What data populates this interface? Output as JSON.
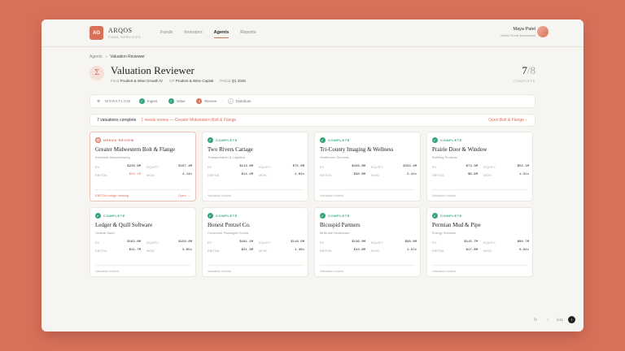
{
  "header": {
    "logo_text": "AG",
    "brand": "ARQOS",
    "brand_sub": "FUND SERVICES",
    "nav": [
      "Funds",
      "Investors",
      "Agents",
      "Reports"
    ],
    "active_nav": "Agents",
    "user_name": "Maya Patel",
    "user_role": "Senior Fund Accountant"
  },
  "breadcrumb": [
    "Agents",
    "Valuation Reviewer"
  ],
  "page": {
    "title": "Valuation Reviewer",
    "meta": [
      {
        "label": "Fund",
        "value": "Prudent & Wise Growth IV"
      },
      {
        "label": "GP",
        "value": "Prudent & Wise Capital"
      },
      {
        "label": "Period",
        "value": "Q1 2026"
      }
    ],
    "count_num": "7",
    "count_den": "/8",
    "count_label": "COMPLETE"
  },
  "workflow": {
    "label": "WORKFLOW",
    "steps": [
      {
        "n": "1",
        "label": "Ingest",
        "state": "done"
      },
      {
        "n": "2",
        "label": "Value",
        "state": "done"
      },
      {
        "n": "3",
        "label": "Review",
        "state": "current"
      },
      {
        "n": "4",
        "label": "Distribute",
        "state": "pending"
      }
    ]
  },
  "banner": {
    "text": "7 valuations complete",
    "alert": "· 1 needs review — Greater Midwestern Bolt & Flange",
    "action": "Open Bolt & Flange ›"
  },
  "cards": [
    {
      "status": "NEEDS REVIEW",
      "name": "Greater Midwestern Bolt & Flange",
      "sector": "Industrial Manufacturing",
      "ev": "$228.9M",
      "equity": "$167.4M",
      "ebitda": "$24.1M",
      "moic": "2.14x",
      "foot": "EBITDA bridge missing",
      "action": "Open →"
    },
    {
      "status": "COMPLETE",
      "name": "Two Rivers Cartage",
      "sector": "Transportation & Logistics",
      "ev": "$113.6M",
      "equity": "$75.6M",
      "ebitda": "$14.2M",
      "moic": "1.62x",
      "foot": "Valuation locked"
    },
    {
      "status": "COMPLETE",
      "name": "Tri-County Imaging & Wellness",
      "sector": "Healthcare Services",
      "ev": "$426.8M",
      "equity": "$334.4M",
      "ebitda": "$38.8M",
      "moic": "2.41x",
      "foot": "Valuation locked"
    },
    {
      "status": "COMPLETE",
      "name": "Prairie Door & Window",
      "sector": "Building Products",
      "ev": "$74.3M",
      "equity": "$52.1M",
      "ebitda": "$9.9M",
      "moic": "1.31x",
      "foot": "Valuation locked"
    },
    {
      "status": "COMPLETE",
      "name": "Ledger & Quill Software",
      "sector": "Vertical SaaS",
      "ev": "$163.8M",
      "equity": "$159.8M",
      "ebitda": "$11.7M",
      "moic": "3.05x",
      "foot": "Valuation locked"
    },
    {
      "status": "COMPLETE",
      "name": "Honest Pretzel Co.",
      "sector": "Consumer Packaged Goods",
      "ev": "$181.1M",
      "equity": "$116.5M",
      "ebitda": "$21.3M",
      "moic": "1.48x",
      "foot": "Valuation locked"
    },
    {
      "status": "COMPLETE",
      "name": "Bicuspid Partners",
      "sector": "Multi-site Healthcare",
      "ev": "$136.0M",
      "equity": "$98.8M",
      "ebitda": "$13.6M",
      "moic": "1.97x",
      "foot": "Valuation locked"
    },
    {
      "status": "COMPLETE",
      "name": "Permian Mud & Pipe",
      "sector": "Energy Services",
      "ev": "$115.7M",
      "equity": "$68.7M",
      "ebitda": "$17.8M",
      "moic": "0.92x",
      "foot": "Valuation locked"
    }
  ],
  "labels": {
    "ev": "EV",
    "equity": "EQUITY",
    "ebitda": "EBITDA",
    "moic": "MOIC"
  },
  "pager": {
    "text": "1/11"
  },
  "colors": {
    "accent": "#d9715a",
    "ok": "#34a57a"
  }
}
